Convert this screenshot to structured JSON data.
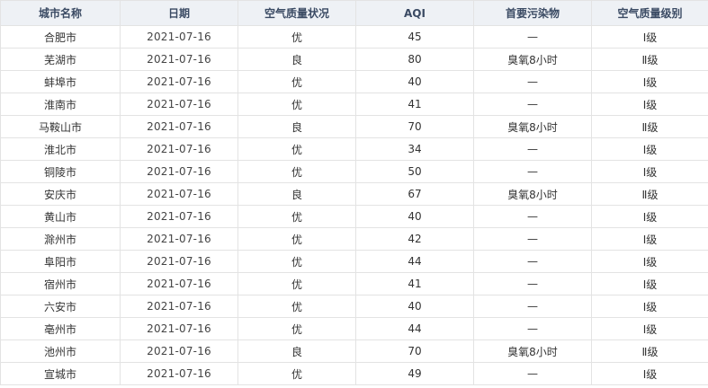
{
  "headers": [
    "城市名称",
    "日期",
    "空气质量状况",
    "AQI",
    "首要污染物",
    "空气质量级别"
  ],
  "rows": [
    [
      "合肥市",
      "2021-07-16",
      "优",
      "45",
      "—",
      "Ⅰ级"
    ],
    [
      "芜湖市",
      "2021-07-16",
      "良",
      "80",
      "臭氧8小时",
      "Ⅱ级"
    ],
    [
      "蚌埠市",
      "2021-07-16",
      "优",
      "40",
      "—",
      "Ⅰ级"
    ],
    [
      "淮南市",
      "2021-07-16",
      "优",
      "41",
      "—",
      "Ⅰ级"
    ],
    [
      "马鞍山市",
      "2021-07-16",
      "良",
      "70",
      "臭氧8小时",
      "Ⅱ级"
    ],
    [
      "淮北市",
      "2021-07-16",
      "优",
      "34",
      "—",
      "Ⅰ级"
    ],
    [
      "铜陵市",
      "2021-07-16",
      "优",
      "50",
      "—",
      "Ⅰ级"
    ],
    [
      "安庆市",
      "2021-07-16",
      "良",
      "67",
      "臭氧8小时",
      "Ⅱ级"
    ],
    [
      "黄山市",
      "2021-07-16",
      "优",
      "40",
      "—",
      "Ⅰ级"
    ],
    [
      "滁州市",
      "2021-07-16",
      "优",
      "42",
      "—",
      "Ⅰ级"
    ],
    [
      "阜阳市",
      "2021-07-16",
      "优",
      "44",
      "—",
      "Ⅰ级"
    ],
    [
      "宿州市",
      "2021-07-16",
      "优",
      "41",
      "—",
      "Ⅰ级"
    ],
    [
      "六安市",
      "2021-07-16",
      "优",
      "40",
      "—",
      "Ⅰ级"
    ],
    [
      "亳州市",
      "2021-07-16",
      "优",
      "44",
      "—",
      "Ⅰ级"
    ],
    [
      "池州市",
      "2021-07-16",
      "良",
      "70",
      "臭氧8小时",
      "Ⅱ级"
    ],
    [
      "宣城市",
      "2021-07-16",
      "优",
      "49",
      "—",
      "Ⅰ级"
    ]
  ],
  "colors": {
    "header_bg": "#eef1f5",
    "header_text": "#3a4a63",
    "border": "#e3e3e3",
    "text": "#333333"
  }
}
